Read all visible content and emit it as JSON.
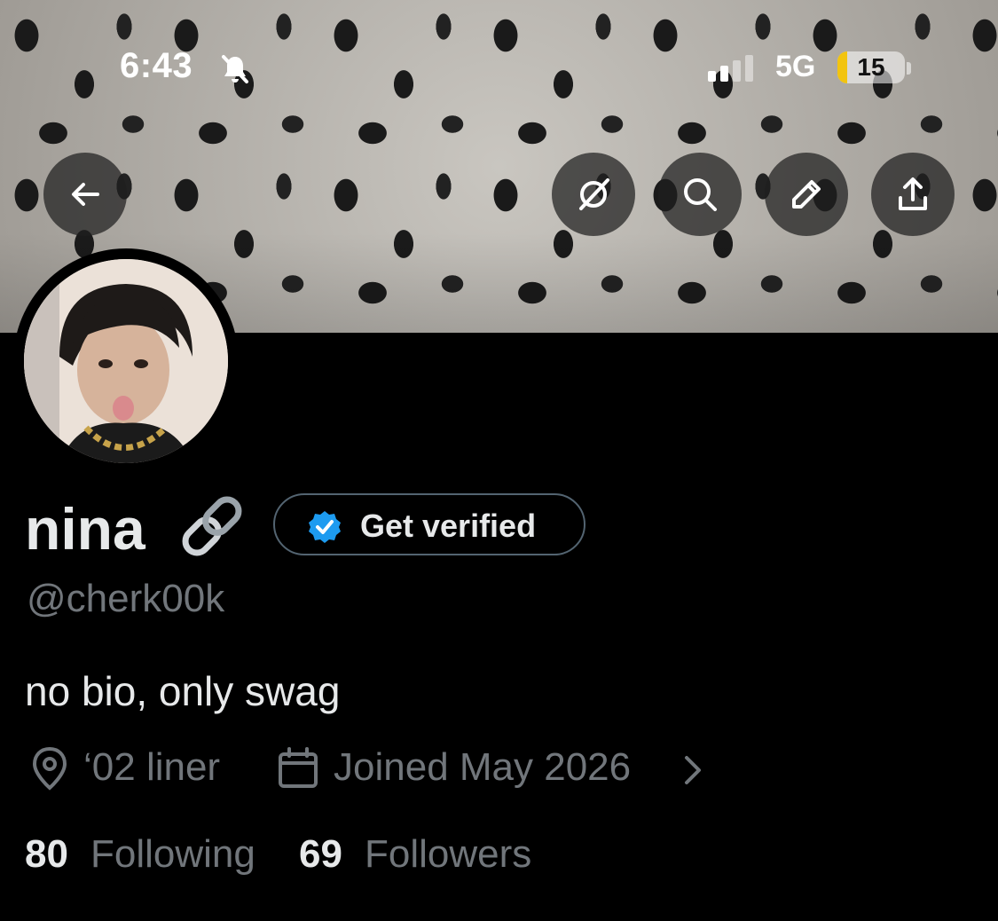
{
  "status_bar": {
    "time": "6:43",
    "network": "5G",
    "battery": "15",
    "battery_level": 0.15,
    "battery_color": "#f2c40f"
  },
  "header": {
    "icons": [
      "back-arrow-icon",
      "grok-icon",
      "search-icon",
      "edit-pencil-icon",
      "share-icon"
    ]
  },
  "profile": {
    "name": "nina",
    "name_emoji": "link-emoji",
    "verify_label": "Get verified",
    "verified_color": "#1d9bf0",
    "handle": "@cherk00k",
    "bio": "no bio, only swag",
    "location": "‘02 liner",
    "joined": "Joined May 2026",
    "following_count": "80",
    "following_label": "Following",
    "followers_count": "69",
    "followers_label": "Followers"
  },
  "colors": {
    "background": "#000000",
    "primary_text": "#e7e9ea",
    "secondary_text": "#71767b"
  }
}
